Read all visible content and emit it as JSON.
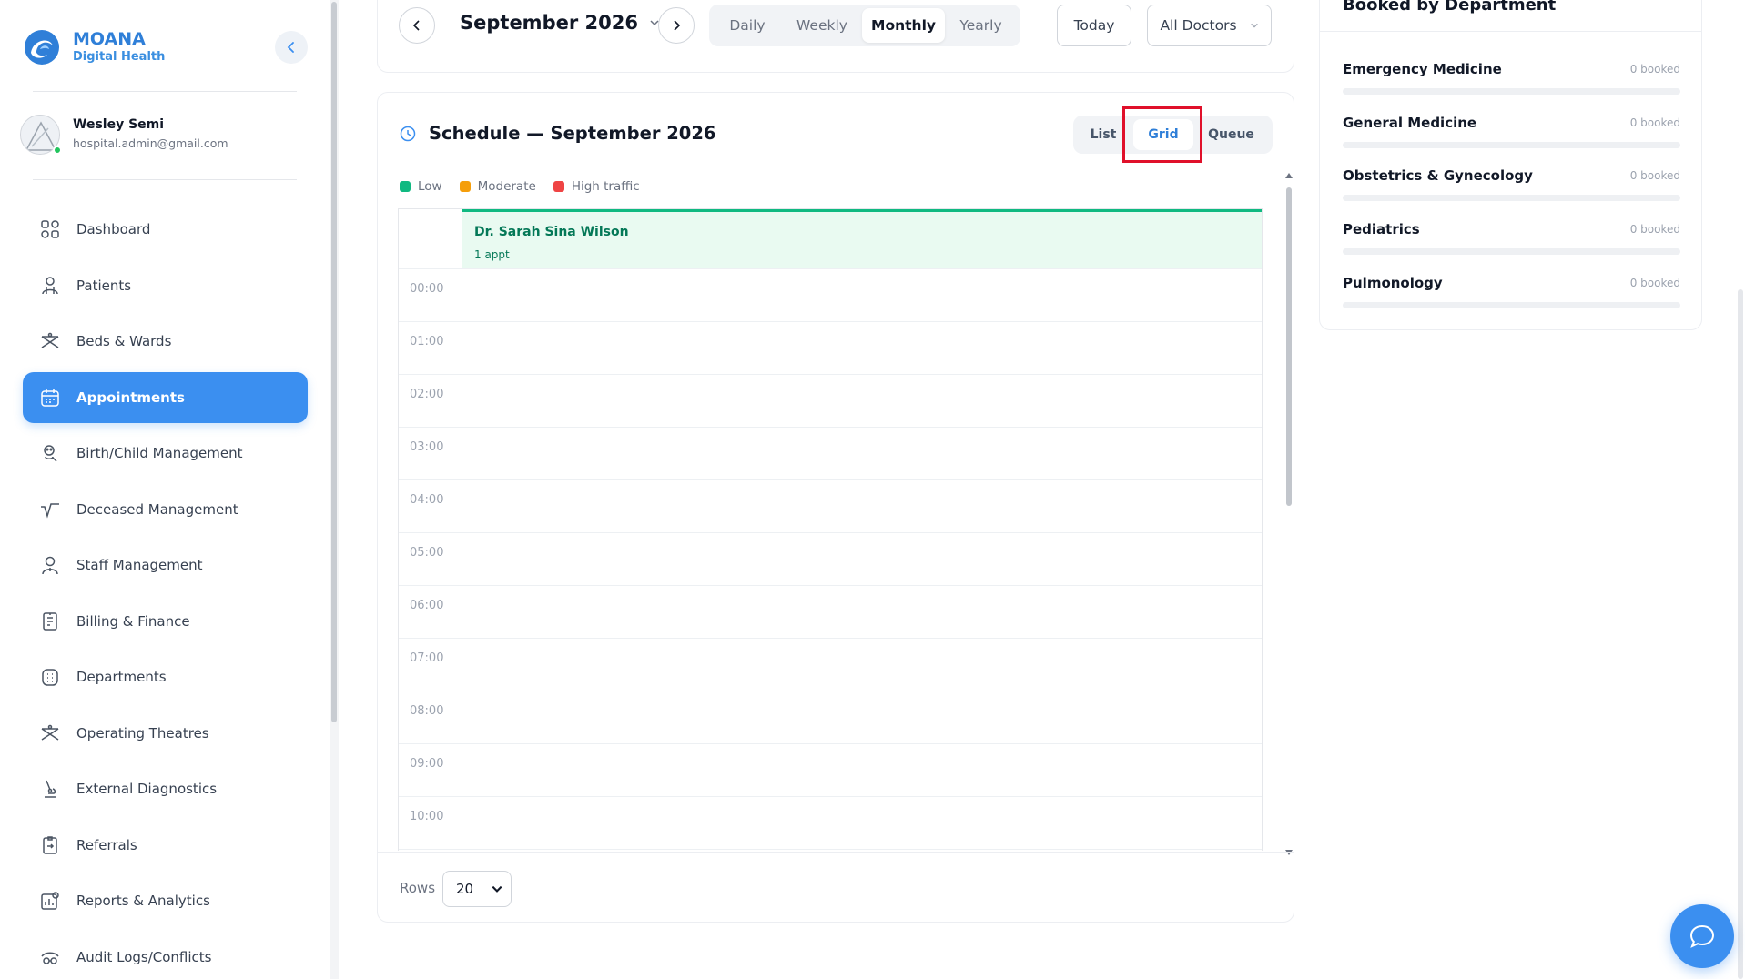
{
  "brand": {
    "name": "MOANA",
    "subtitle": "Digital Health"
  },
  "user": {
    "name": "Wesley Semi",
    "email": "hospital.admin@gmail.com"
  },
  "sidebar": {
    "items": [
      {
        "label": "Dashboard",
        "icon": "grid-icon"
      },
      {
        "label": "Patients",
        "icon": "patient-icon"
      },
      {
        "label": "Beds & Wards",
        "icon": "bed-icon"
      },
      {
        "label": "Appointments",
        "icon": "calendar-icon",
        "active": true
      },
      {
        "label": "Birth/Child Management",
        "icon": "baby-icon"
      },
      {
        "label": "Deceased Management",
        "icon": "pulse-icon"
      },
      {
        "label": "Staff Management",
        "icon": "staff-icon"
      },
      {
        "label": "Billing & Finance",
        "icon": "invoice-icon"
      },
      {
        "label": "Departments",
        "icon": "building-icon"
      },
      {
        "label": "Operating Theatres",
        "icon": "theatre-icon"
      },
      {
        "label": "External Diagnostics",
        "icon": "microscope-icon"
      },
      {
        "label": "Referrals",
        "icon": "referral-icon"
      },
      {
        "label": "Reports & Analytics",
        "icon": "report-icon"
      },
      {
        "label": "Audit Logs/Conflicts",
        "icon": "audit-icon"
      }
    ]
  },
  "toolbar": {
    "month_title": "September 2026",
    "periods": [
      "Daily",
      "Weekly",
      "Monthly",
      "Yearly"
    ],
    "active_period": "Monthly",
    "today_label": "Today",
    "doctor_filter": "All Doctors"
  },
  "schedule": {
    "title": "Schedule — September 2026",
    "views": [
      "List",
      "Grid",
      "Queue"
    ],
    "active_view": "Grid",
    "legend": [
      {
        "label": "Low",
        "color": "#10b981"
      },
      {
        "label": "Moderate",
        "color": "#f59e0b"
      },
      {
        "label": "High traffic",
        "color": "#ef4444"
      }
    ],
    "doctor": {
      "name": "Dr. Sarah Sina Wilson",
      "count": "1 appt"
    },
    "times": [
      "00:00",
      "01:00",
      "02:00",
      "03:00",
      "04:00",
      "05:00",
      "06:00",
      "07:00",
      "08:00",
      "09:00",
      "10:00"
    ],
    "rows_label": "Rows",
    "rows_value": "20"
  },
  "departments": {
    "title": "Booked by Department",
    "items": [
      {
        "name": "Emergency Medicine",
        "count": "0 booked",
        "fill": 0
      },
      {
        "name": "General Medicine",
        "count": "0 booked",
        "fill": 0
      },
      {
        "name": "Obstetrics & Gynecology",
        "count": "0 booked",
        "fill": 0
      },
      {
        "name": "Pediatrics",
        "count": "0 booked",
        "fill": 0
      },
      {
        "name": "Pulmonology",
        "count": "0 booked",
        "fill": 0
      }
    ]
  },
  "colors": {
    "accent": "#3b8ff0",
    "brand": "#2f7fd8",
    "success": "#10b981"
  }
}
